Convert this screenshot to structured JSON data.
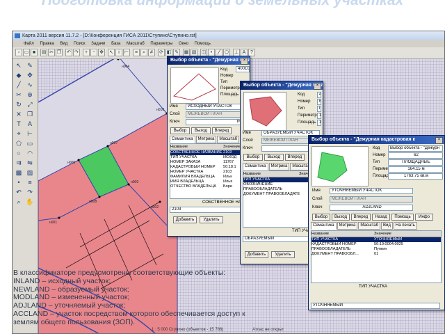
{
  "slide_title": "Подготовка информации о земельных участках",
  "window": {
    "title": "Карта 2011 версия 11.7.2 - [D:\\Конференция ГИСА 2011\\Ступино\\Ступино.rst]",
    "menu": [
      "Файл",
      "Правка",
      "Вид",
      "Поиск",
      "Задачи",
      "База",
      "Масштаб",
      "Параметры",
      "Окно",
      "Помощь"
    ],
    "status": "1 : 5 000     Ступино  (объектов - 15 786)",
    "status_right": "Атлас не открыт"
  },
  "map_labels": {
    "point_a": "н004",
    "point_b": "н005",
    "point_c": "н007",
    "point_d": "н008",
    "point_e": "н009",
    "point_f": "н010",
    "point_g": "н001",
    "point_h": "н002"
  },
  "dialog1": {
    "title": "Выбор объекта - \"Дежурная кадастровая к...",
    "field_labels": [
      "Код",
      "Номер",
      "Тип",
      "Периметр",
      "Площадь"
    ],
    "code_value": "40010000",
    "name_label": "Имя",
    "name_value": "ИСХОДНЫЙ УЧАСТОК",
    "layer_label": "Слой",
    "layer_value": "МЕЖЕВОЙ ПЛАН",
    "key_label": "Ключ",
    "key_value": "INLA",
    "buttons": [
      "Выбор",
      "Выход",
      "Вперед"
    ],
    "tabs": [
      "Семантика",
      "Метрика",
      "Масштаб"
    ],
    "grid_header": [
      "Название",
      "Значение"
    ],
    "rows": [
      [
        "СОБСТВЕННОЕ НАЗВАНИЕ",
        "2103"
      ],
      [
        "ТИП УЧАСТКА",
        "ИСХОД"
      ],
      [
        "НОМЕР ЗАКАЗА",
        "11767"
      ],
      [
        "КАДАСТРОВЫЙ НОМЕР",
        "50:18:1"
      ],
      [
        "НОМЕР УЧАСТКА",
        "2103"
      ],
      [
        "ФАМИЛИЯ ВЛАДЕЛЬЦА",
        "Ильк"
      ],
      [
        "ИМЯ ВЛАДЕЛЬЦА",
        "Илья"
      ],
      [
        "ОТЧЕСТВО ВЛАДЕЛЬЦА",
        "Бори"
      ]
    ],
    "bottom_title": "СОБСТВЕННОЕ НА",
    "bottom_value": "2103",
    "bottom_buttons": [
      "Добавить",
      "Удалить"
    ]
  },
  "dialog2": {
    "title": "Выбор объекта - \"Дежурная кадастровая к",
    "field_labels": [
      "Код",
      "Номер",
      "Тип",
      "Периметр",
      "Площадь"
    ],
    "field_values": [
      "40010001",
      "61",
      "ПЛОЩАДНЫЕ",
      "161.83 м",
      "1537.96 кв.м"
    ],
    "name_label": "Имя",
    "name_value": "ОБРАЗУЕМЫЙ УЧАСТОК",
    "layer_label": "Слой",
    "layer_value": "МЕЖЕВОЙ ПЛАН",
    "key_label": "Ключ",
    "buttons": [
      "Выбор",
      "Выход",
      "Вперед"
    ],
    "tabs": [
      "Семантика",
      "Метрика",
      "Масштаб"
    ],
    "grid_header": [
      "Название",
      "Значение"
    ],
    "rows": [
      "ТИП УЧАСТКА",
      "ОБОЗНАЧЕНИЕ",
      "ПРАВООБЛАДАТЕЛЬ",
      "ДОКУМЕНТ ПРАВООБЛАДАТЕ"
    ],
    "bottom_title": "ТИП УЧАСТ",
    "bottom_value": "ОБРАЗУЕМЫЙ",
    "bottom_buttons": [
      "Добавить",
      "Удалить"
    ]
  },
  "dialog3": {
    "title": "Выбор объекта - \"Дежурная кадастровая к",
    "field_labels": [
      "Код",
      "Номер",
      "Тип",
      "Периметр",
      "Площадь"
    ],
    "field_values": [
      "Выбор объекта - \"Дежурн",
      "62",
      "ПЛОЩАДНЫЕ",
      "164.15 м",
      "1763.75 кв.м"
    ],
    "name_label": "Имя",
    "name_value": "УТОЧНЯЕМЫЙ УЧАСТОК",
    "layer_label": "Слой",
    "layer_value": "МЕЖЕВОЙ ПЛАН",
    "key_label": "Ключ",
    "key_value": "ADJLAND",
    "buttons": [
      "Выбор",
      "Выход",
      "Вперед",
      "Назад",
      "Помощь",
      "Инфо"
    ],
    "tabs": [
      "Семантика",
      "Метрика",
      "Масштаб",
      "Вид",
      "На печать"
    ],
    "grid_header": [
      "Название",
      "Значение"
    ],
    "rows": [
      [
        "ТИП УЧАСТКА",
        "УТОЧНЯЕМЫЙ"
      ],
      [
        "КАДАСТРОВЫЙ НОМЕР",
        "50:19:0004:0025"
      ],
      [
        "ПРАВООБЛАДАТЕЛЬ",
        "Пупкин"
      ],
      [
        "ДОКУМЕНТ ПРАВООБЛ...",
        "01"
      ]
    ],
    "bottom_title": "ТИП УЧАСТКА",
    "bottom_value": "УТОЧНЯЕМЫЙ"
  },
  "caption": [
    "В классификаторе предусмотрены соответствующие объекты:",
    "INLAND – исходный участок;",
    "NEWLAND – образуемый участок;",
    "MODLAND – измененный участок;",
    "ADJLAND – уточняемый участок;",
    "ACCLAND – участок посредством которого обеспечивается доступ к",
    "землям общего пользования (ЗОП)."
  ],
  "colors": {
    "parcel_red": "#e9868c",
    "parcel_green": "#4bc860",
    "boundary_blue": "#3949a8",
    "title_bar": "#0a246a",
    "selected_row": "#0a246a"
  }
}
